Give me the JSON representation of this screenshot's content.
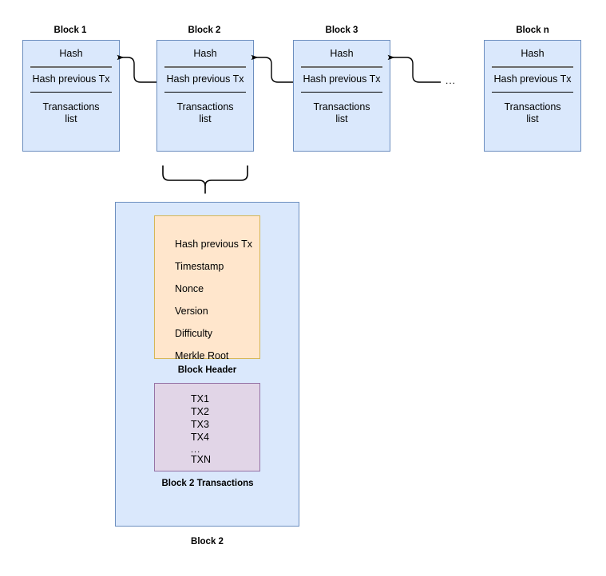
{
  "diagram": {
    "title": "Blockchain block structure diagram",
    "background": "#ffffff",
    "colors": {
      "block_fill": "#dae8fc",
      "block_stroke": "#6c8ebf",
      "header_fill": "#ffe6cc",
      "header_stroke": "#d6b656",
      "transactions_fill": "#e1d5e7",
      "transactions_stroke": "#9673a6",
      "connector": "#000000",
      "rule_thick": "#6b6b6b",
      "rule_thin": "#000000"
    }
  },
  "chain": {
    "ellipsis": "...",
    "blocks": [
      {
        "title": "Block 1",
        "hash_label": "Hash",
        "prev_hash_label": "Hash previous Tx",
        "transactions_label_line1": "Transactions",
        "transactions_label_line2": "list"
      },
      {
        "title": "Block 2",
        "hash_label": "Hash",
        "prev_hash_label": "Hash previous Tx",
        "transactions_label_line1": "Transactions",
        "transactions_label_line2": "list"
      },
      {
        "title": "Block 3",
        "hash_label": "Hash",
        "prev_hash_label": "Hash previous Tx",
        "transactions_label_line1": "Transactions",
        "transactions_label_line2": "list"
      },
      {
        "title": "Block n",
        "hash_label": "Hash",
        "prev_hash_label": "Hash previous Tx",
        "transactions_label_line1": "Transactions",
        "transactions_label_line2": "list"
      }
    ]
  },
  "expanded": {
    "caption": "Block 2",
    "header": {
      "caption": "Block Header",
      "fields": [
        "Hash previous Tx",
        "Timestamp",
        "Nonce",
        "Version",
        "Difficulty",
        "Merkle Root"
      ]
    },
    "transactions": {
      "caption": "Block 2 Transactions",
      "items": [
        "TX1",
        "TX2",
        "TX3",
        "TX4",
        "...",
        "TXN"
      ]
    }
  }
}
